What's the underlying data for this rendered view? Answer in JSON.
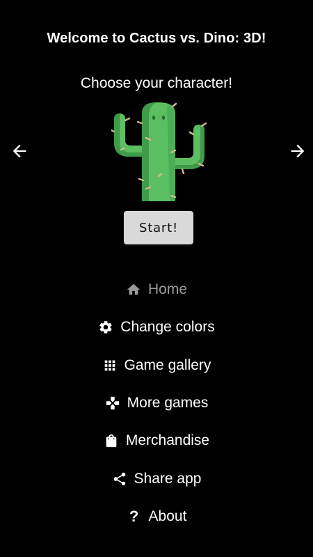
{
  "header": {
    "title": "Welcome to Cactus vs. Dino: 3D!",
    "subtitle": "Choose your character!"
  },
  "character_picker": {
    "character": "cactus",
    "prev_icon": "arrow-left-icon",
    "next_icon": "arrow-right-icon"
  },
  "start_button": {
    "label": "Start!"
  },
  "menu": {
    "items": [
      {
        "label": "Home",
        "icon": "home-icon",
        "active": true
      },
      {
        "label": "Change colors",
        "icon": "gear-icon",
        "active": false
      },
      {
        "label": "Game gallery",
        "icon": "grid-icon",
        "active": false
      },
      {
        "label": "More games",
        "icon": "gamepad-icon",
        "active": false
      },
      {
        "label": "Merchandise",
        "icon": "shopping-bag-icon",
        "active": false
      },
      {
        "label": "Share app",
        "icon": "share-icon",
        "active": false
      },
      {
        "label": "About",
        "icon": "question-icon",
        "active": false
      }
    ]
  },
  "colors": {
    "background": "#000000",
    "text": "#ffffff",
    "active_menu": "#9a9a9a",
    "button_bg": "#d9d9d9",
    "cactus_green": "#5bbf62",
    "cactus_dark": "#3f9a4a"
  }
}
